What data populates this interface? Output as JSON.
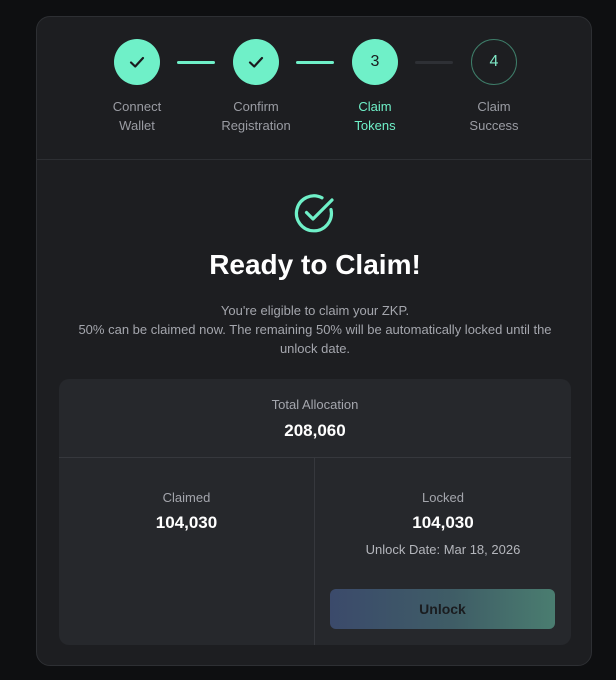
{
  "colors": {
    "accent": "#6ff0c8",
    "card_bg": "#1d1e21",
    "panel_bg": "#26282c"
  },
  "stepper": {
    "steps": [
      {
        "number": "",
        "label": "Connect\nWallet",
        "state": "done",
        "icon": "check-icon"
      },
      {
        "number": "",
        "label": "Confirm\nRegistration",
        "state": "done",
        "icon": "check-icon"
      },
      {
        "number": "3",
        "label": "Claim\nTokens",
        "state": "active"
      },
      {
        "number": "4",
        "label": "Claim\nSuccess",
        "state": "pending"
      }
    ]
  },
  "hero": {
    "icon": "check-circle-icon",
    "title": "Ready to Claim!",
    "line1": "You're eligible to claim your ZKP.",
    "line2": "50% can be claimed now. The remaining 50% will be automatically locked until the",
    "line3": "unlock date."
  },
  "allocation": {
    "total_label": "Total Allocation",
    "total_value": "208,060",
    "claimed_label": "Claimed",
    "claimed_value": "104,030",
    "locked_label": "Locked",
    "locked_value": "104,030",
    "unlock_date": "Unlock Date: Mar 18, 2026",
    "unlock_button": "Unlock"
  }
}
